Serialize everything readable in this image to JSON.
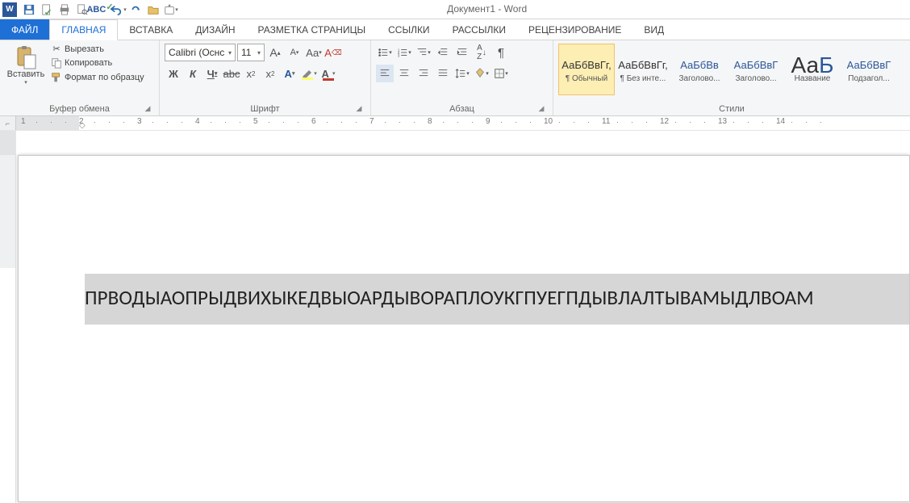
{
  "app_title": "Документ1 - Word",
  "tabs": {
    "file": "ФАЙЛ",
    "home": "ГЛАВНАЯ",
    "insert": "ВСТАВКА",
    "design": "ДИЗАЙН",
    "layout": "РАЗМЕТКА СТРАНИЦЫ",
    "references": "ССЫЛКИ",
    "mailings": "РАССЫЛКИ",
    "review": "РЕЦЕНЗИРОВАНИЕ",
    "view": "ВИД"
  },
  "clipboard": {
    "paste": "Вставить",
    "cut": "Вырезать",
    "copy": "Копировать",
    "format_painter": "Формат по образцу",
    "group": "Буфер обмена"
  },
  "font": {
    "name": "Calibri (Оснс",
    "size": "11",
    "group": "Шрифт",
    "bold": "Ж",
    "italic": "К",
    "underline": "Ч",
    "strike": "abc",
    "sub": "x₂",
    "sup": "x²"
  },
  "paragraph": {
    "group": "Абзац"
  },
  "styles": {
    "group": "Стили",
    "items": [
      {
        "preview": "АаБбВвГг,",
        "name": "¶ Обычный",
        "sel": true,
        "cls": ""
      },
      {
        "preview": "АаБбВвГг,",
        "name": "¶ Без инте...",
        "sel": false,
        "cls": ""
      },
      {
        "preview": "АаБбВв",
        "name": "Заголово...",
        "sel": false,
        "cls": "blue"
      },
      {
        "preview": "АаБбВвГ",
        "name": "Заголово...",
        "sel": false,
        "cls": "blue"
      },
      {
        "preview": "АаБ",
        "name": "Название",
        "sel": false,
        "cls": "big"
      },
      {
        "preview": "АаБбВвГ",
        "name": "Подзагол...",
        "sel": false,
        "cls": "blue"
      }
    ]
  },
  "ruler": {
    "numbers": [
      1,
      2,
      3,
      4,
      5,
      6,
      7,
      8,
      9,
      10,
      11,
      12,
      13,
      14
    ]
  },
  "document": {
    "selected_text": "ПРВОДЫАОПРЫДВИХЫКЕДВЫОАРДЫВОРАПЛОУКГПУЕГПДЫВЛАЛТЫВАМЫДЛВОАМ"
  }
}
